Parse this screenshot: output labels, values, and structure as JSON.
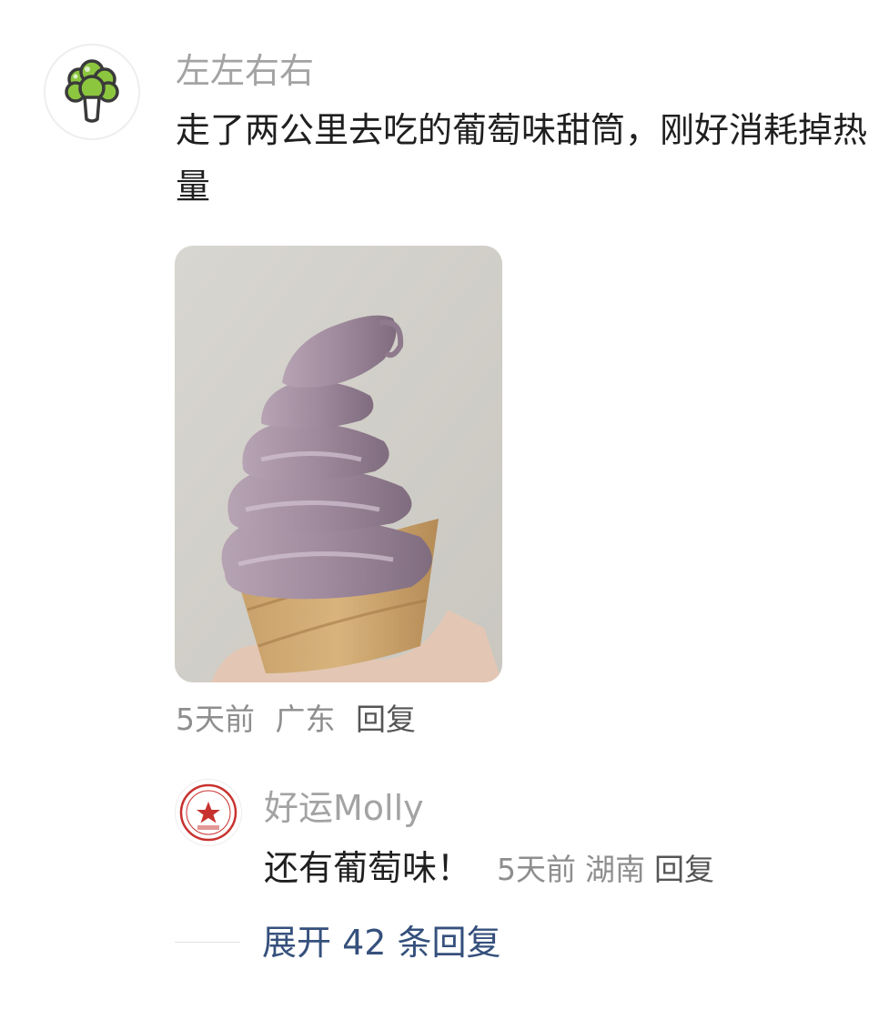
{
  "comment": {
    "avatar_icon": "broccoli-icon",
    "author": "左左右右",
    "text": "走了两公里去吃的葡萄味甜筒，刚好消耗掉热量",
    "image_subject": "grape-flavored-soft-serve-cone",
    "time": "5天前",
    "location": "广东",
    "reply_label": "回复"
  },
  "reply": {
    "avatar_icon": "red-star-seal-icon",
    "author": "好运Molly",
    "text": "还有葡萄味！",
    "time": "5天前",
    "location": "湖南",
    "reply_label": "回复"
  },
  "expand": {
    "label": "展开 42 条回复"
  },
  "colors": {
    "author": "#a3a3a3",
    "text": "#1f1f1f",
    "meta": "#8e8e8e",
    "expand_link": "#35507c",
    "avatar_green": "#8cc63f"
  }
}
